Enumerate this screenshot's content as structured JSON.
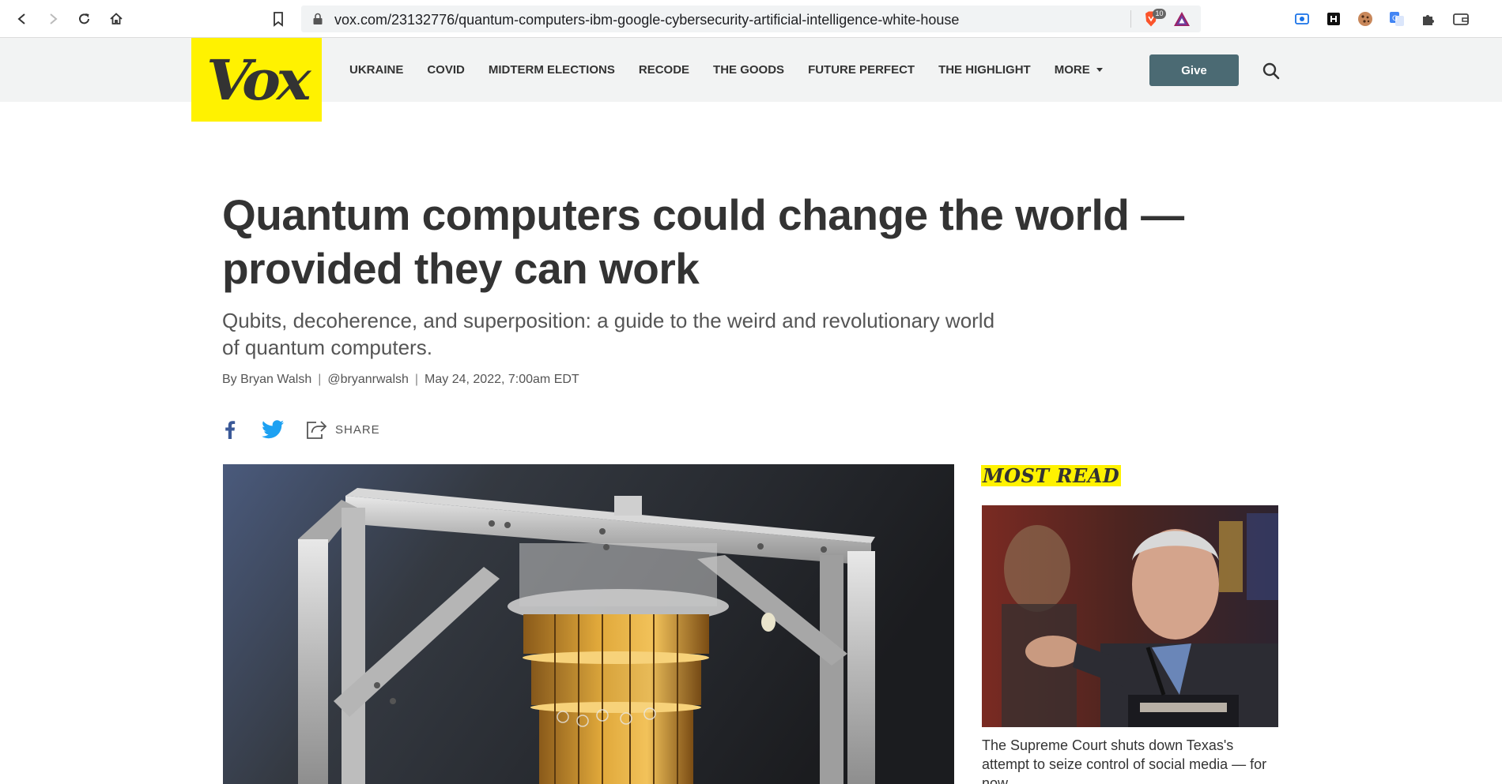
{
  "browser": {
    "url": "vox.com/23132776/quantum-computers-ibm-google-cybersecurity-artificial-intelligence-white-house",
    "shield_count": "10",
    "icons": [
      "back-icon",
      "forward-icon",
      "reload-icon",
      "home-icon",
      "bookmark-icon",
      "lock-icon",
      "brave-shield-icon",
      "brave-rewards-icon",
      "screenshot-extension-icon",
      "h-extension-icon",
      "cookie-extension-icon",
      "translate-extension-icon",
      "extensions-puzzle-icon",
      "wallet-icon"
    ]
  },
  "header": {
    "logo_text": "Vox",
    "nav": [
      "UKRAINE",
      "COVID",
      "MIDTERM ELECTIONS",
      "RECODE",
      "THE GOODS",
      "FUTURE PERFECT",
      "THE HIGHLIGHT",
      "MORE"
    ],
    "give_label": "Give"
  },
  "article": {
    "headline": "Quantum computers could change the world — provided they can work",
    "dek": "Qubits, decoherence, and superposition: a guide to the weird and revolutionary world of quantum computers.",
    "byline_prefix": "By",
    "author": "Bryan Walsh",
    "handle": "@bryanrwalsh",
    "date": "May 24, 2022, 7:00am EDT",
    "share_label": "SHARE"
  },
  "sidebar": {
    "heading": "MOST READ",
    "story_title": "The Supreme Court shuts down Texas's attempt to seize control of social media — for now"
  },
  "colors": {
    "brand_yellow": "#fff200",
    "give_button": "#4b6a73",
    "facebook": "#3b5998",
    "twitter": "#1da1f2",
    "header_bg": "#f2f3f3"
  }
}
